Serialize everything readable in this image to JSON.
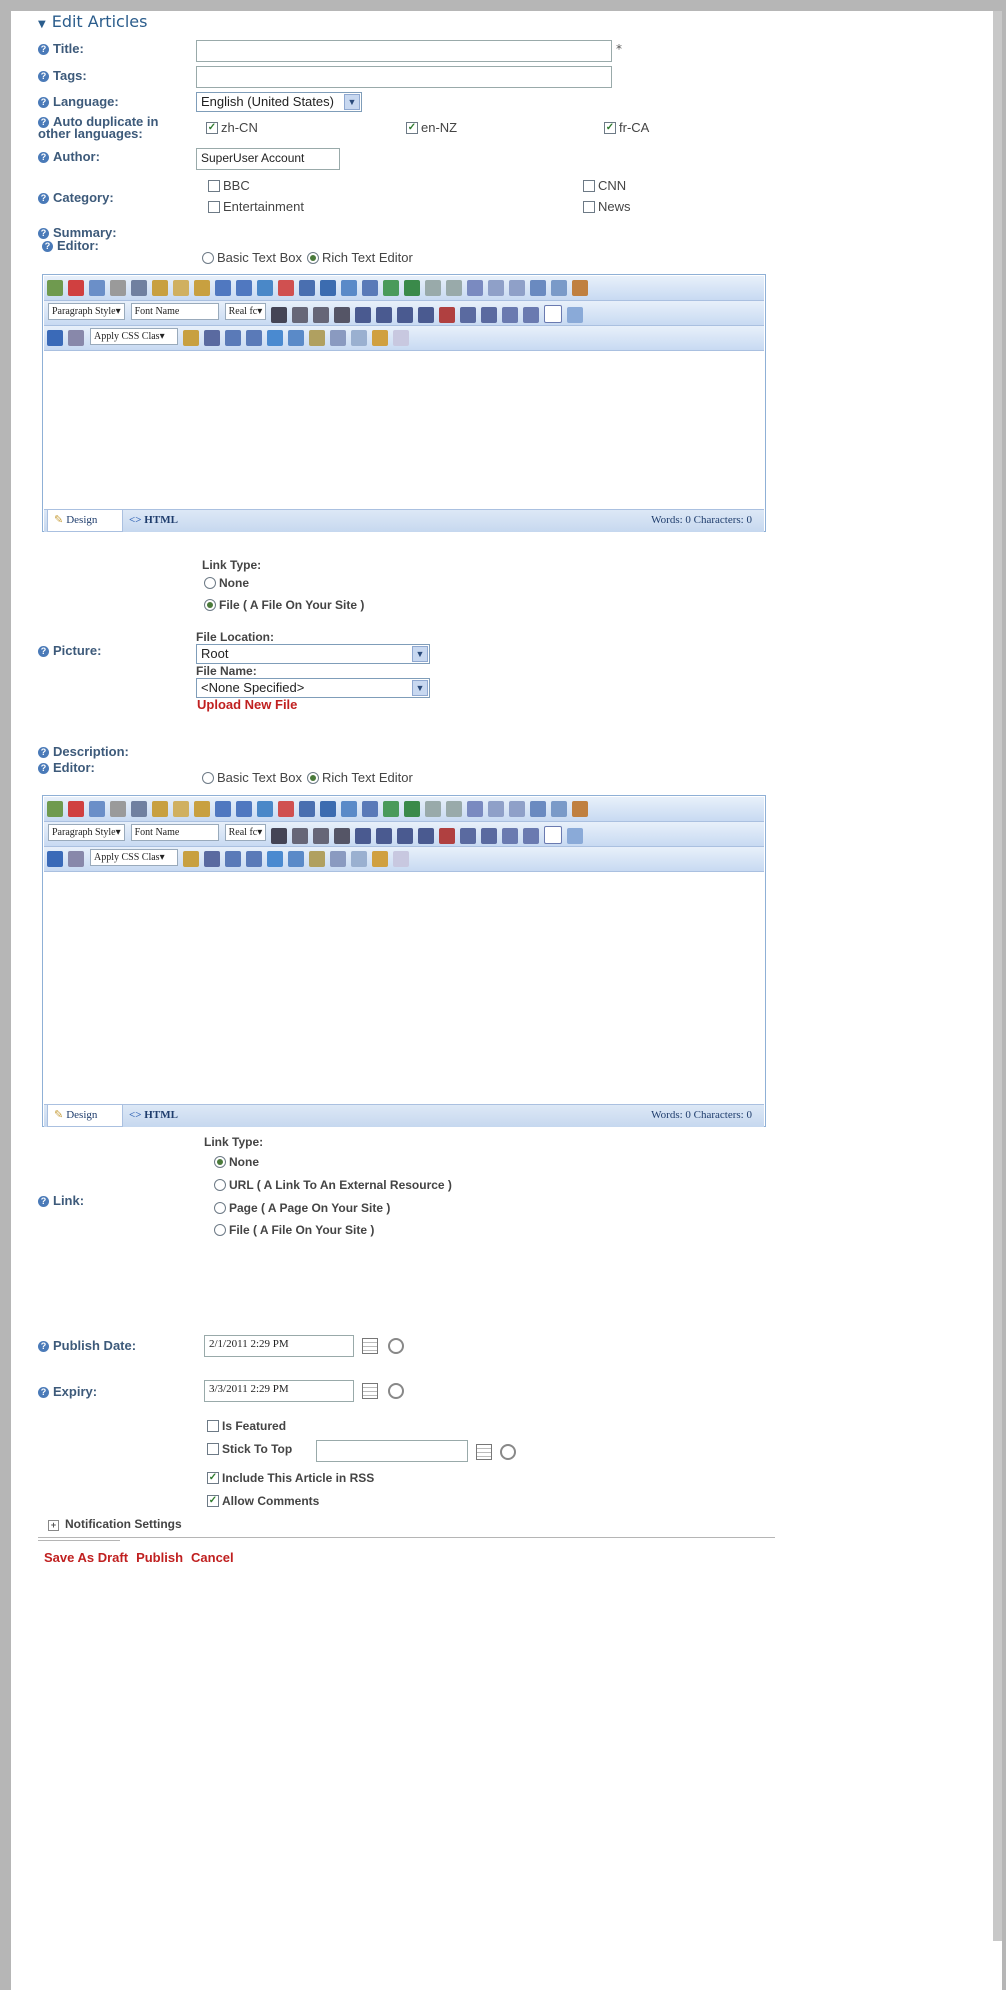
{
  "section_title": "Edit Articles",
  "labels": {
    "title": "Title:",
    "tags": "Tags:",
    "language": "Language:",
    "auto_duplicate_1": "Auto duplicate in",
    "auto_duplicate_2": "other languages:",
    "author": "Author:",
    "category": "Category:",
    "summary": "Summary:",
    "editor": "Editor:",
    "picture": "Picture:",
    "description": "Description:",
    "link": "Link:",
    "publish_date": "Publish Date:",
    "expiry": "Expiry:"
  },
  "required_mark": "*",
  "title_value": "",
  "tags_value": "",
  "language_value": "English (United States)",
  "duplicate_languages": [
    "zh-CN",
    "en-NZ",
    "fr-CA"
  ],
  "author_value": "SuperUser Account",
  "categories": [
    "BBC",
    "CNN",
    "Entertainment",
    "News"
  ],
  "editor_modes": [
    "Basic Text Box",
    "Rich Text Editor"
  ],
  "editor_toolbar": {
    "paragraph_style": "Paragraph Style▾",
    "font_name": "Font Name",
    "real_font": "Real fc▾",
    "apply_css": "Apply CSS Clas▾"
  },
  "editor_footer": {
    "design": "Design",
    "html": "HTML",
    "stats": "Words: 0   Characters: 0"
  },
  "picture": {
    "link_type_label": "Link Type:",
    "options": [
      "None",
      "File ( A File On Your Site )"
    ],
    "file_location_label": "File Location:",
    "file_location_value": "Root",
    "file_name_label": "File Name:",
    "file_name_value": "<None Specified>",
    "upload": "Upload New File"
  },
  "link": {
    "link_type_label": "Link Type:",
    "options": [
      "None",
      "URL ( A Link To An External Resource )",
      "Page ( A Page On Your Site )",
      "File ( A File On Your Site )"
    ]
  },
  "publish_date_value": "2/1/2011 2:29 PM",
  "expiry_value": "3/3/2011 2:29 PM",
  "options": {
    "is_featured": "Is Featured",
    "stick_to_top": "Stick To Top",
    "include_rss": "Include This Article in RSS",
    "allow_comments": "Allow Comments"
  },
  "notification_settings": "Notification Settings",
  "actions": [
    "Save As Draft",
    "Publish",
    "Cancel"
  ],
  "colors": {
    "action_red": "#c02020",
    "label_blue": "#3d5a7a",
    "editor_border": "#8fb0d6"
  }
}
